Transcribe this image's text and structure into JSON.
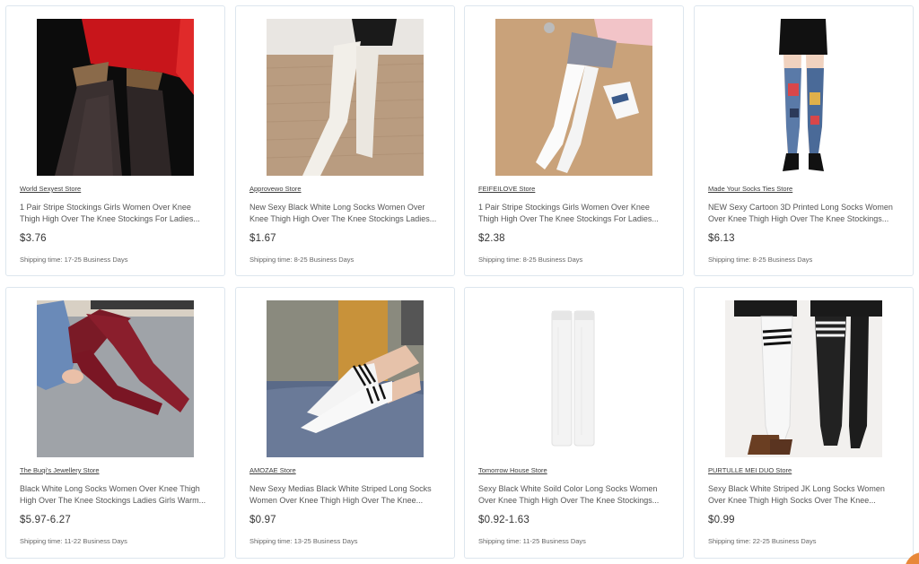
{
  "products": [
    {
      "store": "World Sexyest Store",
      "title_line1": "1 Pair Stripe Stockings Girls Women Over Knee",
      "title_line2": "Thigh High Over The Knee Stockings For Ladies...",
      "price": "$3.76",
      "shipping": "Shipping time: 17-25 Business Days"
    },
    {
      "store": "Approvewo Store",
      "title_line1": "New Sexy Black White Long Socks Women Over",
      "title_line2": "Knee Thigh High Over The Knee Stockings Ladies...",
      "price": "$1.67",
      "shipping": "Shipping time: 8-25 Business Days"
    },
    {
      "store": "FEIFEILOVE Store",
      "title_line1": "1 Pair Stripe Stockings Girls Women Over Knee",
      "title_line2": "Thigh High Over The Knee Stockings For Ladies...",
      "price": "$2.38",
      "shipping": "Shipping time: 8-25 Business Days"
    },
    {
      "store": "Made Your Socks Ties Store",
      "title_line1": "NEW Sexy Cartoon 3D Printed Long Socks Women",
      "title_line2": "Over Knee Thigh High Over The Knee Stockings...",
      "price": "$6.13",
      "shipping": "Shipping time: 8-25 Business Days"
    },
    {
      "store": "The Buqi's Jewellery Store",
      "title_line1": "Black White Long Socks Women Over Knee Thigh",
      "title_line2": "High Over The Knee Stockings Ladies Girls Warm...",
      "price": "$5.97-6.27",
      "shipping": "Shipping time: 11-22 Business Days"
    },
    {
      "store": "AMOZAE Store",
      "title_line1": "New Sexy Medias Black White Striped Long Socks",
      "title_line2": "Women Over Knee Thigh High Over The Knee...",
      "price": "$0.97",
      "shipping": "Shipping time: 13-25 Business Days"
    },
    {
      "store": "Tomorrow House Store",
      "title_line1": "Sexy Black White Soild Color Long Socks Women",
      "title_line2": "Over Knee Thigh High Over The Knee Stockings...",
      "price": "$0.92-1.63",
      "shipping": "Shipping time: 11-25 Business Days"
    },
    {
      "store": "PURTULLE MEI DUO Store",
      "title_line1": "Sexy Black White Striped JK Long Socks Women",
      "title_line2": "Over Knee Thigh High Socks Over The Knee...",
      "price": "$0.99",
      "shipping": "Shipping time: 22-25 Business Days"
    }
  ],
  "colors": {
    "card_border": "#dde6ee",
    "floating_button": "#e8883a"
  }
}
